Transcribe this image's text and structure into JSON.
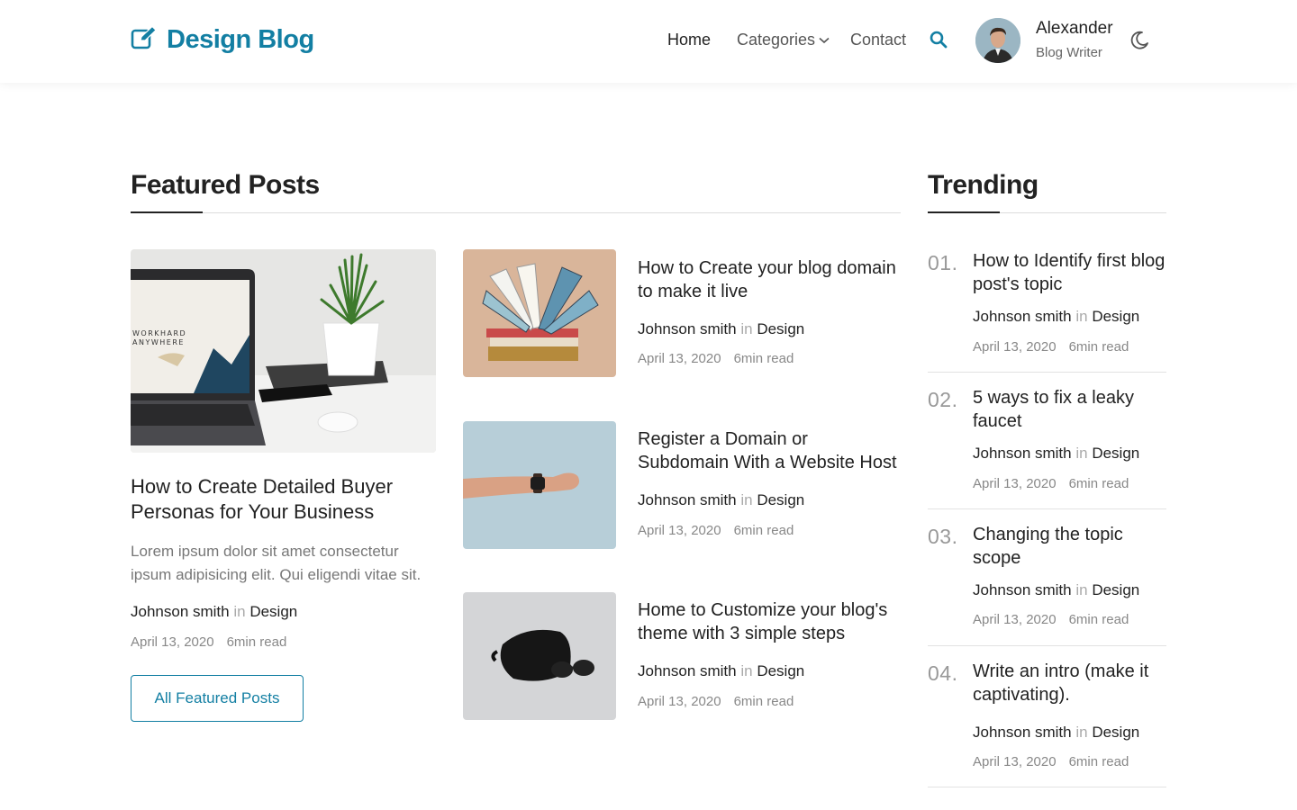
{
  "header": {
    "logo_text": "Design Blog",
    "logo_icon": "edit-icon",
    "nav": {
      "home": "Home",
      "categories": "Categories",
      "contact": "Contact"
    },
    "user": {
      "name": "Alexander",
      "role": "Blog Writer"
    }
  },
  "featured": {
    "title": "Featured Posts",
    "main": {
      "title": "How to Create Detailed Buyer Personas for Your Business",
      "excerpt": "Lorem ipsum dolor sit amet consectetur ipsum adipisicing elit. Qui eligendi vitae sit.",
      "author": "Johnson smith",
      "in": "in",
      "category": "Design",
      "date": "April 13, 2020",
      "read": "6min read",
      "image_text": "WORKHARD ANYWHERE"
    },
    "button": "All Featured Posts",
    "posts": [
      {
        "title": "How to Create your blog domain to make it live",
        "author": "Johnson smith",
        "in": "in",
        "category": "Design",
        "date": "April 13, 2020",
        "read": "6min read"
      },
      {
        "title": "Register a Domain or Subdomain With a Website Host",
        "author": "Johnson smith",
        "in": "in",
        "category": "Design",
        "date": "April 13, 2020",
        "read": "6min read"
      },
      {
        "title": "Home to Customize your blog's theme with 3 simple steps",
        "author": "Johnson smith",
        "in": "in",
        "category": "Design",
        "date": "April 13, 2020",
        "read": "6min read"
      }
    ]
  },
  "trending": {
    "title": "Trending",
    "items": [
      {
        "num": "01.",
        "title": "How to Identify first blog post's topic",
        "author": "Johnson smith",
        "in": "in",
        "category": "Design",
        "date": "April 13, 2020",
        "read": "6min read"
      },
      {
        "num": "02.",
        "title": "5 ways to fix a leaky faucet",
        "author": "Johnson smith",
        "in": "in",
        "category": "Design",
        "date": "April 13, 2020",
        "read": "6min read"
      },
      {
        "num": "03.",
        "title": "Changing the topic scope",
        "author": "Johnson smith",
        "in": "in",
        "category": "Design",
        "date": "April 13, 2020",
        "read": "6min read"
      },
      {
        "num": "04.",
        "title": "Write an intro (make it captivating).",
        "author": "Johnson smith",
        "in": "in",
        "category": "Design",
        "date": "April 13, 2020",
        "read": "6min read"
      }
    ]
  },
  "colors": {
    "brand": "#137fa3",
    "text": "#222222",
    "muted": "#888888"
  }
}
